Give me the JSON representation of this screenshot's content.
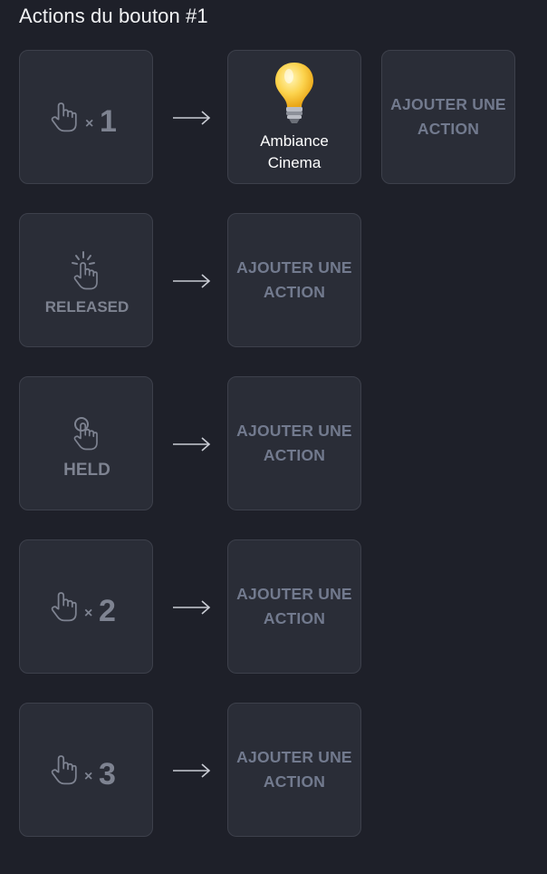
{
  "page": {
    "title": "Actions du bouton #1"
  },
  "rows": [
    {
      "trigger": {
        "icon": "hand-tap-icon",
        "label": "1"
      },
      "action": {
        "label": "Ambiance Cinema",
        "icon": "lightbulb-icon"
      },
      "add_label": "AJOUTER UNE ACTION"
    },
    {
      "trigger": {
        "icon": "hand-release-icon",
        "label": "RELEASED"
      },
      "add_label": "AJOUTER UNE ACTION"
    },
    {
      "trigger": {
        "icon": "hand-hold-icon",
        "label": "HELD"
      },
      "add_label": "AJOUTER UNE ACTION"
    },
    {
      "trigger": {
        "icon": "hand-tap-icon",
        "label": "2"
      },
      "add_label": "AJOUTER UNE ACTION"
    },
    {
      "trigger": {
        "icon": "hand-tap-icon",
        "label": "3"
      },
      "add_label": "AJOUTER UNE ACTION"
    }
  ],
  "colors": {
    "background": "#1e2029",
    "tile": "#2a2d37",
    "tile_border": "#3d404b",
    "muted": "#727a8e"
  }
}
